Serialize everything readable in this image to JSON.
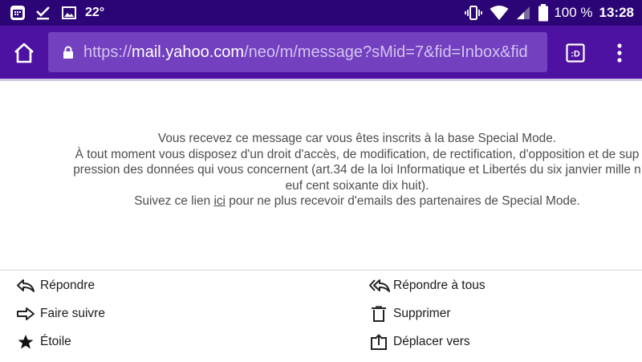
{
  "status_bar": {
    "temperature": "22°",
    "battery_percent": "100 %",
    "time": "13:28"
  },
  "browser": {
    "url_scheme": "https://",
    "url_domain": "mail.yahoo.com",
    "url_path": "/neo/m/message?sMid=7&fid=Inbox&fid",
    "tab_switcher_label": ":D"
  },
  "email": {
    "footer_line1": "Vous recevez ce message car vous êtes inscrits à la base Special Mode.",
    "footer_line2": "À tout moment vous disposez d'un droit d'accès, de modification, de rectification, d'opposition et de sup",
    "footer_line3": "pression des données qui vous concernent (art.34 de la loi Informatique et Libertés du six janvier mille n",
    "footer_line4": "euf cent soixante dix huit).",
    "footer_line5_before": "Suivez ce lien ",
    "footer_line5_link": "ici",
    "footer_line5_after": " pour ne plus recevoir d'emails des partenaires de Special Mode."
  },
  "actions": {
    "reply": "Répondre",
    "reply_all": "Répondre à tous",
    "forward": "Faire suivre",
    "delete": "Supprimer",
    "star": "Étoile",
    "move": "Déplacer vers"
  }
}
